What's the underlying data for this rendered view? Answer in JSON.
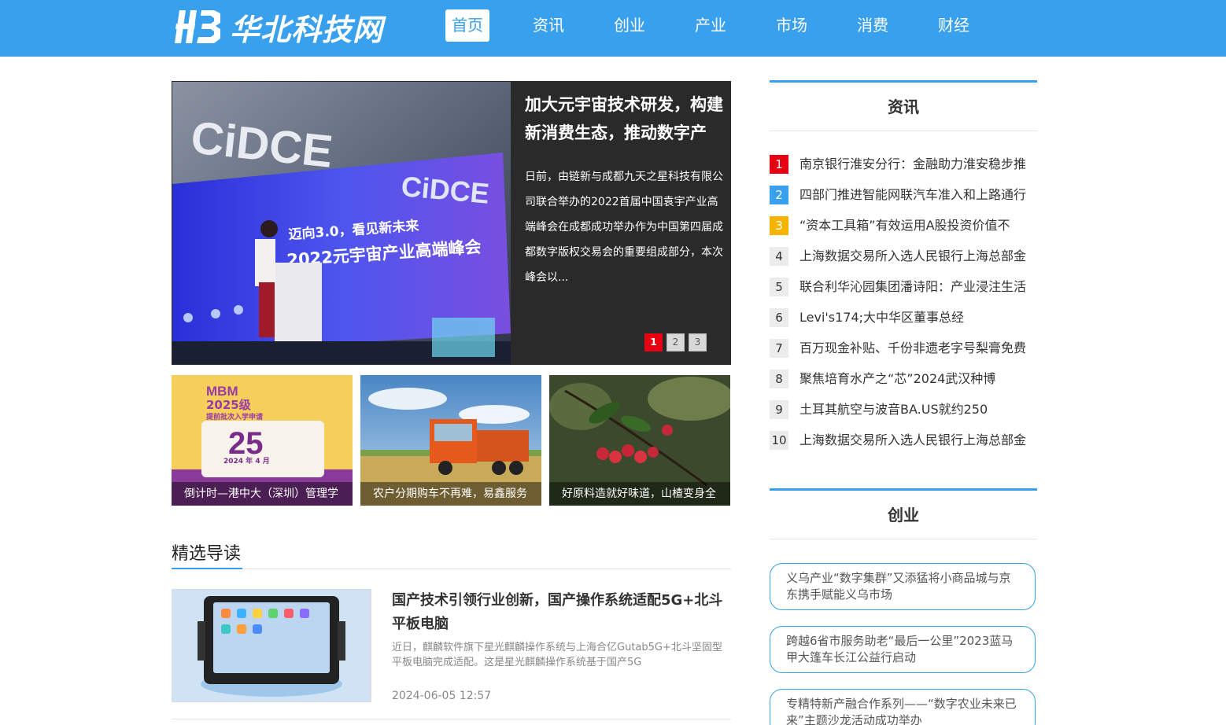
{
  "header": {
    "logo_text": "华北科技网",
    "nav": [
      "首页",
      "资讯",
      "创业",
      "产业",
      "市场",
      "消费",
      "财经"
    ]
  },
  "hero": {
    "title": "加大元宇宙技术研发，构建新消费生态，推动数字产",
    "summary": "日前，由链新与成都九天之星科技有限公司联合举办的2022首届中国袁宇产业高端峰会在成都成功举办作为中国第四届成都数字版权交易会的重要组成部分，本次峰会以...",
    "image": {
      "brand1": "CiDCE",
      "brand2": "CiDCE",
      "banner_line1": "迈向3.0，看见新未来",
      "banner_line2": "2022元宇宙产业高端峰会"
    },
    "pages": [
      "1",
      "2",
      "3"
    ]
  },
  "thumbs": [
    {
      "caption": "倒计时—港中大（深圳）管理学",
      "img_line1": "MBM",
      "img_line2": "2025级",
      "img_line3": "提前批次入学申请",
      "img_num": "25",
      "img_date": "2024 年 4 月"
    },
    {
      "caption": "农户分期购车不再难，易鑫服务"
    },
    {
      "caption": "好原料造就好味道，山楂变身全"
    }
  ],
  "section": {
    "title": "精选导读"
  },
  "article": {
    "title": "国产技术引领行业创新，国产操作系统适配5G+北斗平板电脑",
    "summary": "近日，麒麟软件旗下星光麒麟操作系统与上海合亿Gutab5G+北斗坚固型平板电脑完成适配。这是星光麒麟操作系统基于国产5G",
    "date": "2024-06-05 12:57"
  },
  "sidebar": {
    "news": {
      "title": "资讯",
      "items": [
        {
          "num": "1",
          "text": "南京银行淮安分行：金融助力淮安稳步推"
        },
        {
          "num": "2",
          "text": "四部门推进智能网联汽车准入和上路通行"
        },
        {
          "num": "3",
          "text": "“资本工具箱”有效运用A股投资价值不"
        },
        {
          "num": "4",
          "text": "上海数据交易所入选人民银行上海总部金"
        },
        {
          "num": "5",
          "text": "联合利华沁园集团潘诗阳：产业浸注生活"
        },
        {
          "num": "6",
          "text": "Levi's174;大中华区董事总经"
        },
        {
          "num": "7",
          "text": "百万现金补贴、千份非遗老字号梨膏免费"
        },
        {
          "num": "8",
          "text": "聚焦培育水产之“芯”2024武汉种博"
        },
        {
          "num": "9",
          "text": "土耳其航空与波音BA.US就约250"
        },
        {
          "num": "10",
          "text": "上海数据交易所入选人民银行上海总部金"
        }
      ]
    },
    "startup": {
      "title": "创业",
      "items": [
        "义乌产业“数字集群”又添猛将小商品城与京东携手赋能义乌市场",
        "跨越6省市服务助老“最后一公里”2023蓝马甲大篷车长江公益行启动",
        "专精特新产融合作系列——“数字农业未来已来”主题沙龙活动成功举办"
      ]
    }
  }
}
